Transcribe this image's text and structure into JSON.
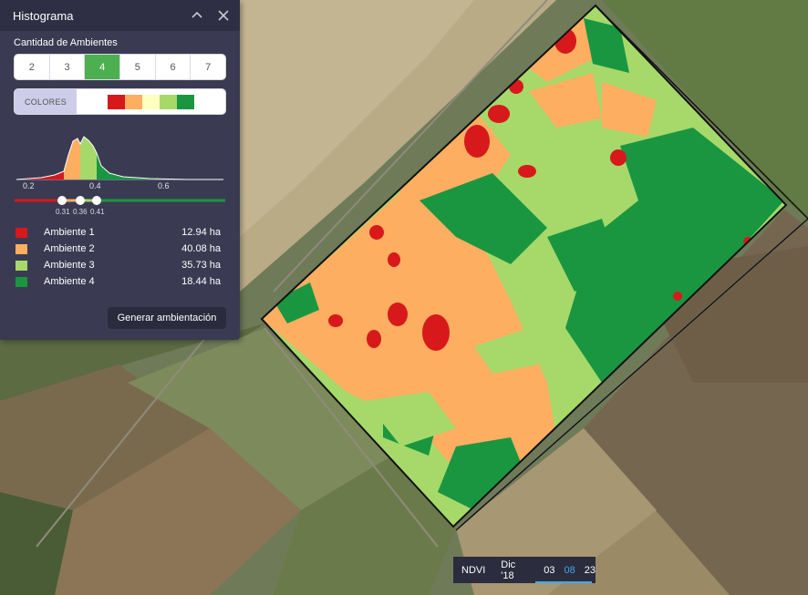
{
  "panel": {
    "title": "Histograma",
    "section_label": "Cantidad de Ambientes",
    "zone_options": [
      "2",
      "3",
      "4",
      "5",
      "6",
      "7"
    ],
    "selected_zones": "4",
    "colors_label": "COLORES",
    "palette": [
      "#d7191c",
      "#fdae61",
      "#ffffbf",
      "#a6d96a",
      "#1a9641"
    ],
    "histogram": {
      "x_ticks": [
        "0.2",
        "0.4",
        "0.6"
      ],
      "thresholds": [
        "0.31",
        "0.36",
        "0.41"
      ]
    },
    "zones": [
      {
        "name": "Ambiente 1",
        "area": "12.94 ha",
        "color": "#d7191c"
      },
      {
        "name": "Ambiente 2",
        "area": "40.08 ha",
        "color": "#fdae61"
      },
      {
        "name": "Ambiente 3",
        "area": "35.73 ha",
        "color": "#a6d96a"
      },
      {
        "name": "Ambiente 4",
        "area": "18.44 ha",
        "color": "#1a9641"
      }
    ],
    "generate_label": "Generar ambientación"
  },
  "timebar": {
    "layer": "NDVI",
    "date": "Dic '18",
    "days": [
      "03",
      "08",
      "23"
    ],
    "active_day": "08"
  }
}
